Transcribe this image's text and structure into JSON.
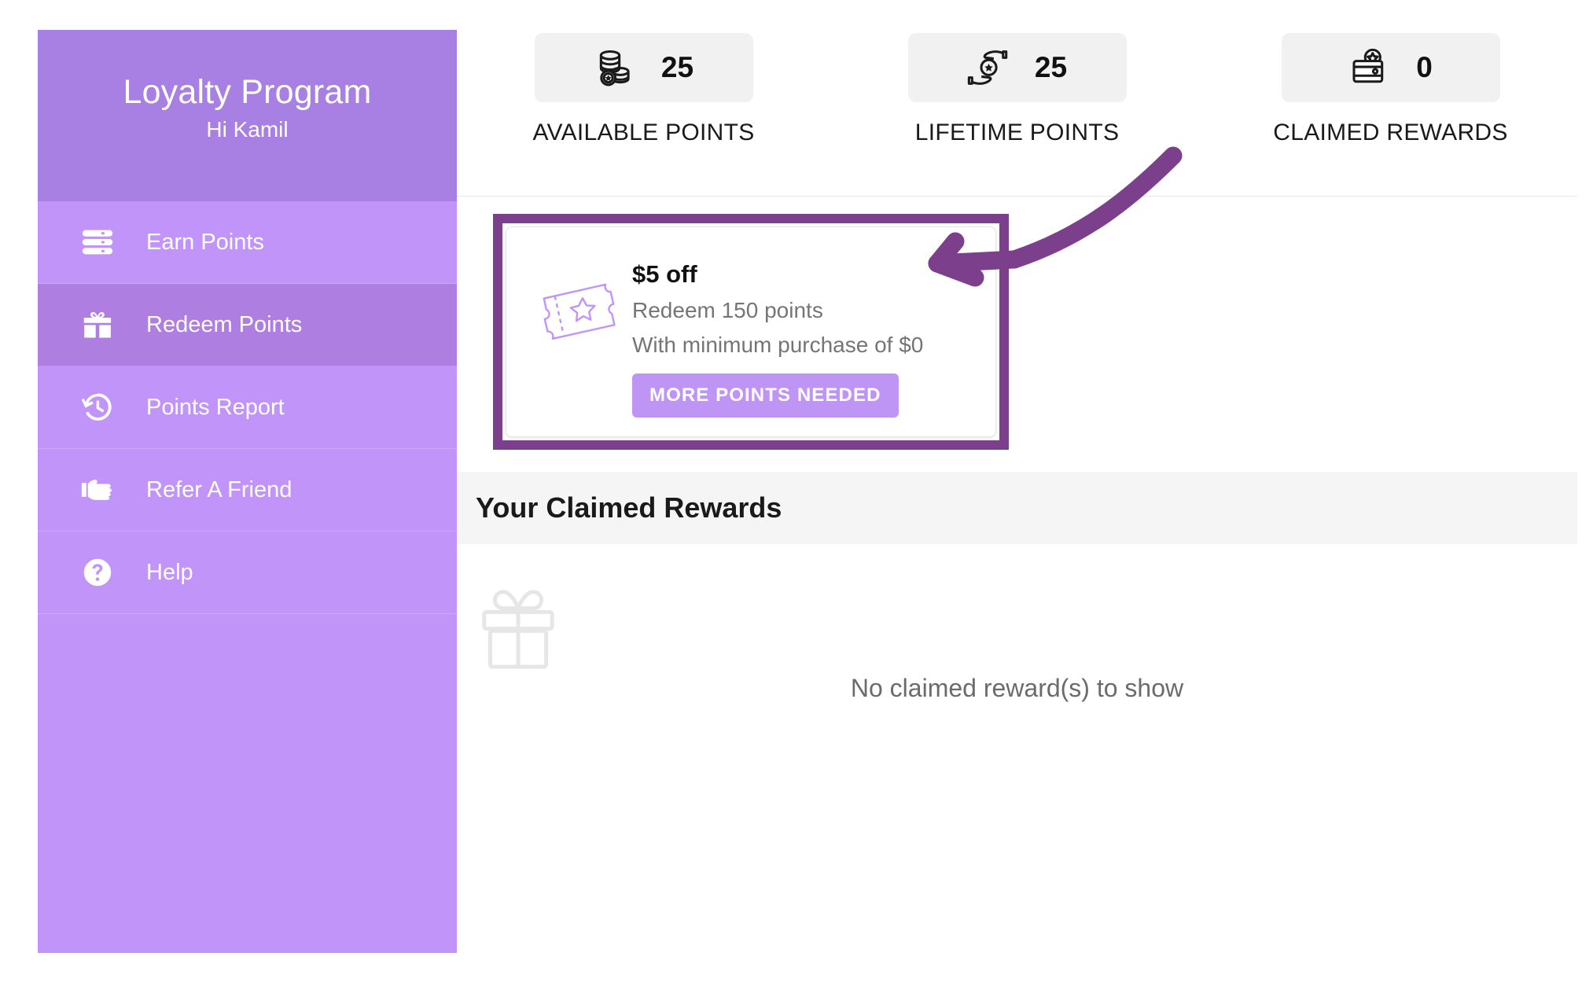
{
  "sidebar": {
    "brand_title": "Loyalty Program",
    "greeting": "Hi Kamil",
    "items": [
      {
        "label": "Earn Points",
        "icon": "layers-icon",
        "active": false
      },
      {
        "label": "Redeem Points",
        "icon": "gift-icon",
        "active": true
      },
      {
        "label": "Points Report",
        "icon": "history-clock-icon",
        "active": false
      },
      {
        "label": "Refer A Friend",
        "icon": "pointing-hand-icon",
        "active": false
      },
      {
        "label": "Help",
        "icon": "question-mark-circle-icon",
        "active": false
      }
    ]
  },
  "stats": [
    {
      "value": "25",
      "label": "AVAILABLE POINTS",
      "icon": "coin-stack-icon"
    },
    {
      "value": "25",
      "label": "LIFETIME POINTS",
      "icon": "hand-holding-coin-icon"
    },
    {
      "value": "0",
      "label": "CLAIMED REWARDS",
      "icon": "wallet-star-icon"
    }
  ],
  "rewards": [
    {
      "title": "$5 off",
      "redeem_text": "Redeem 150 points",
      "minimum_text": "With minimum purchase of $0",
      "button_label": "MORE POINTS NEEDED",
      "icon": "ticket-star-icon",
      "highlighted": true
    }
  ],
  "claimed_section": {
    "title": "Your Claimed Rewards",
    "empty_text": "No claimed reward(s) to show",
    "empty_icon": "gift-outline-icon"
  },
  "annotation": {
    "type": "curved-arrow",
    "color": "#7b3f8c",
    "points_to": "reward-card"
  },
  "colors": {
    "sidebar_bg": "#c194fa",
    "sidebar_header_bg": "#a87fe3",
    "sidebar_active_bg": "#ae7fe0",
    "highlight_border": "#7b3f8c",
    "button_bg": "#be94f5",
    "stat_pill_bg": "#f1f1f1",
    "section_band_bg": "#f5f5f5"
  }
}
